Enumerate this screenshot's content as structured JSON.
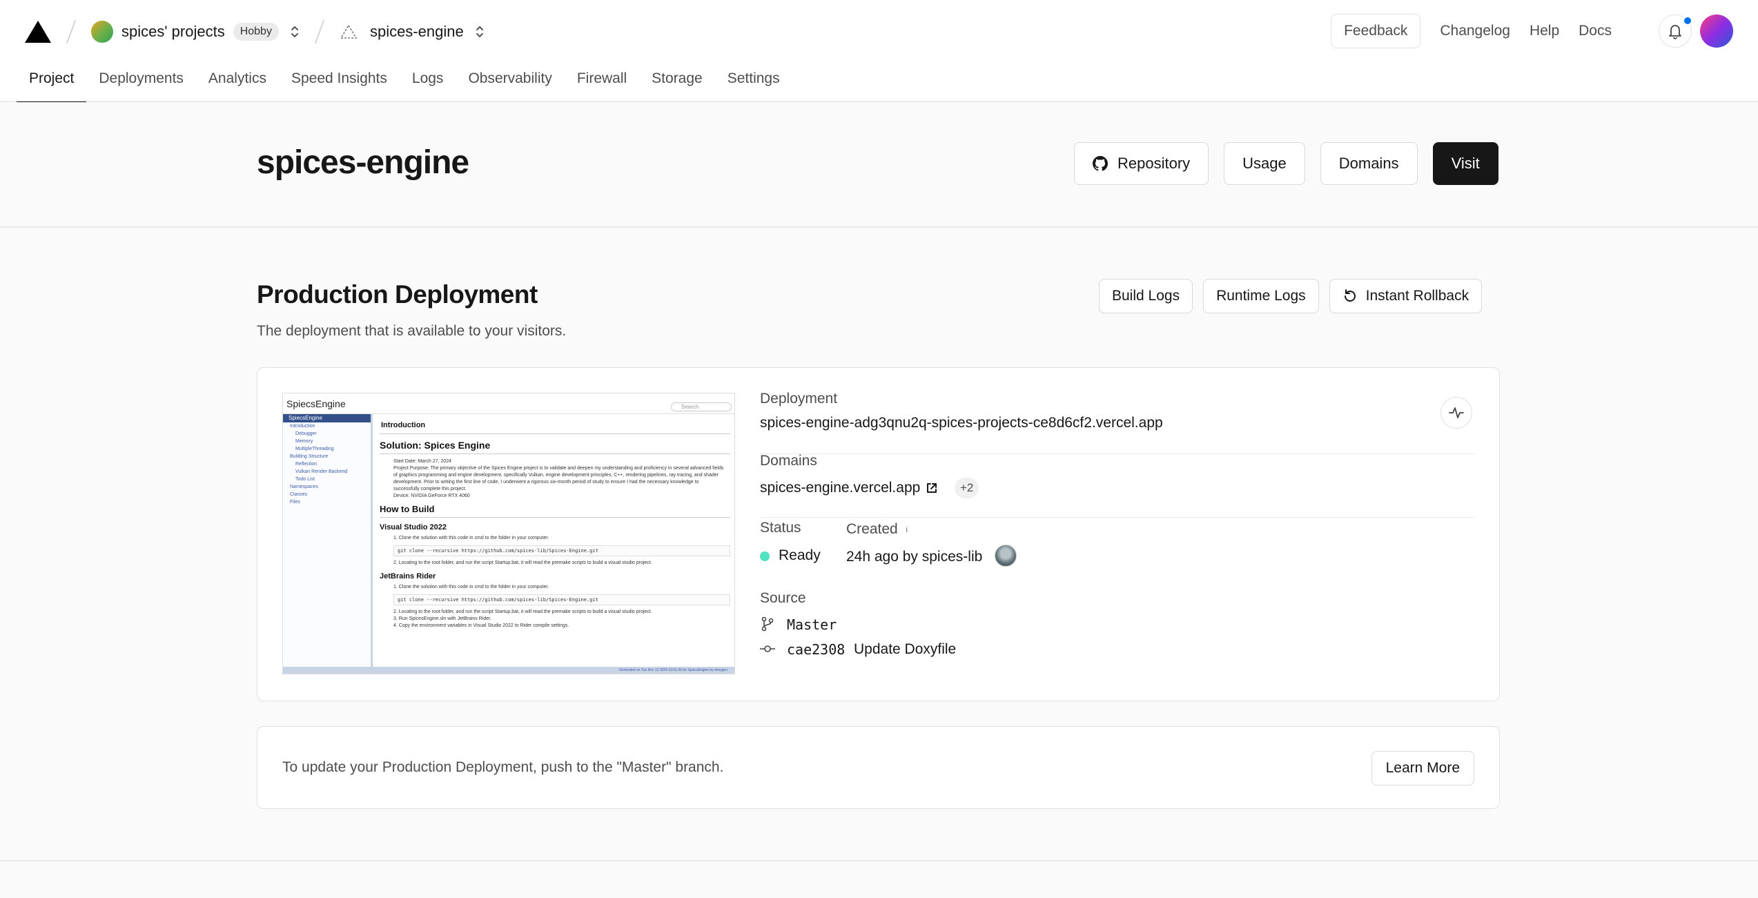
{
  "header": {
    "team": "spices' projects",
    "plan_badge": "Hobby",
    "project": "spices-engine",
    "feedback": "Feedback",
    "links": [
      "Changelog",
      "Help",
      "Docs"
    ]
  },
  "tabs": [
    "Project",
    "Deployments",
    "Analytics",
    "Speed Insights",
    "Logs",
    "Observability",
    "Firewall",
    "Storage",
    "Settings"
  ],
  "active_tab": "Project",
  "title": {
    "text": "spices-engine",
    "actions": {
      "repository": "Repository",
      "usage": "Usage",
      "domains": "Domains",
      "visit": "Visit"
    }
  },
  "production": {
    "title": "Production Deployment",
    "subtitle": "The deployment that is available to your visitors.",
    "actions": {
      "build_logs": "Build Logs",
      "runtime_logs": "Runtime Logs",
      "rollback": "Instant Rollback"
    },
    "deployment_label": "Deployment",
    "deployment_url": "spices-engine-adg3qnu2q-spices-projects-ce8d6cf2.vercel.app",
    "domains_label": "Domains",
    "domain": "spices-engine.vercel.app",
    "domains_extra": "+2",
    "status_label": "Status",
    "status": "Ready",
    "created_label": "Created",
    "created_info": "i",
    "created": "24h ago by spices-lib",
    "source_label": "Source",
    "branch": "Master",
    "commit_hash": "cae2308",
    "commit_message": "Update Doxyfile",
    "colors": {
      "ready": "#50e3c2",
      "notification": "#0070f3"
    }
  },
  "preview": {
    "site_title": "SpiecsEngine",
    "search": "Search",
    "sidebar_selected": "SpiecsEngine",
    "sidebar": [
      {
        "label": "Introduction",
        "indent": 1
      },
      {
        "label": "Debugger",
        "indent": 2
      },
      {
        "label": "Memory",
        "indent": 2
      },
      {
        "label": "MultipleThreading",
        "indent": 2
      },
      {
        "label": "Building Structure",
        "indent": 1
      },
      {
        "label": "Reflection",
        "indent": 2
      },
      {
        "label": "Vulkan Render Backend",
        "indent": 2
      },
      {
        "label": "Todo List",
        "indent": 2
      },
      {
        "label": "Namespaces",
        "indent": 1
      },
      {
        "label": "Classes",
        "indent": 1
      },
      {
        "label": "Files",
        "indent": 1
      }
    ],
    "intro": "Introduction",
    "h1": "Solution: Spices Engine",
    "bullets": [
      "Start Date: March 27, 2024",
      "Project Purpose: The primary objective of the Spices Engine project is to validate and deepen my understanding and proficiency in several advanced fields",
      "of graphics programming and engine development, specifically Vulkan, engine development principles, C++, rendering pipelines, ray tracing, and shader",
      "development. Prior to writing the first line of code, I underwent a rigorous six-month period of study to ensure I had the necessary knowledge to",
      "successfully complete this project.",
      "Device: NVIDIA GeForce RTX 4060"
    ],
    "h2": "How to Build",
    "vs_title": "Visual Studio 2022",
    "vs_step1": "1. Clone the solution with this code in cmd to the folder in your computer.",
    "code": "git clone --recursive https://github.com/spices-lib/Spices-Engine.git",
    "vs_step2": "2. Locating to the root folder, and run the script Startup.bat, it will read the premake scripts to build a visual studio project.",
    "rider_title": "JetBrains Rider",
    "rider_step1": "1. Clone the solution with this code in cmd to the folder in your computer.",
    "rider_step2": "2. Locating to the root folder, and run the script Startup.bat, it will read the premake scripts to build a visual studio project.",
    "rider_step3": "3. Run SpicesEngine.sln with JetBrains Rider.",
    "rider_step4": "4. Copy the environment variables in Visual Studio 2022 to Rider compile settings.",
    "footer": "Generated on Tue Nov 12 2024 10:01:36 for SpiecsEngine by doxygen"
  },
  "notice": {
    "text": "To update your Production Deployment, push to the \"Master\" branch.",
    "button": "Learn More"
  }
}
